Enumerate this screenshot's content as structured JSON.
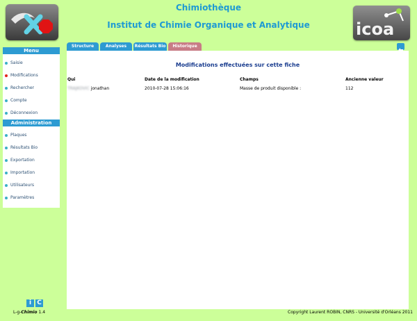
{
  "header": {
    "title": "Chimiothèque",
    "subtitle": "Institut de Chimie Organique et Analytique",
    "logo_right_text": "icoa"
  },
  "sidebar": {
    "menu_heading": "Menu",
    "menu_items": [
      {
        "label": "Saisie",
        "dot_color": "#3ab0c7"
      },
      {
        "label": "Modifications",
        "dot_color": "#e1261c"
      },
      {
        "label": "Rechercher",
        "dot_color": "#3ab0c7"
      },
      {
        "label": "Compte",
        "dot_color": "#3ab0c7"
      },
      {
        "label": "Déconnexion",
        "dot_color": "#3ab0c7"
      }
    ],
    "admin_heading": "Administration",
    "admin_items": [
      {
        "label": "Plaques",
        "dot_color": "#3ab0c7"
      },
      {
        "label": "Résultats Bio",
        "dot_color": "#3ab0c7"
      },
      {
        "label": "Exportation",
        "dot_color": "#3ab0c7"
      },
      {
        "label": "Importation",
        "dot_color": "#3ab0c7"
      },
      {
        "label": "Utilisateurs",
        "dot_color": "#3ab0c7"
      },
      {
        "label": "Paramètres",
        "dot_color": "#3ab0c7"
      }
    ]
  },
  "tabs": [
    {
      "label": "Structure",
      "color": "#2d9bd2"
    },
    {
      "label": "Analyses",
      "color": "#2d9bd2"
    },
    {
      "label": "Résultats Bio",
      "color": "#2d9bd2"
    },
    {
      "label": "Historique",
      "color": "#c87c86"
    }
  ],
  "main": {
    "title": "Modifications effectuées sur cette fiche",
    "columns": [
      "Qui",
      "Date de la modification",
      "Champs",
      "Ancienne valeur"
    ],
    "rows": [
      {
        "qui_name": "TRAJKOVIC",
        "qui_first": "jonathan",
        "date": "2010-07-28 15:06:16",
        "champs": "Masse de produit disponible :",
        "ancienne_valeur": "112"
      }
    ]
  },
  "footer": {
    "ic_letters": [
      "i",
      "C"
    ],
    "app_prefix": "L-g-",
    "app_name": "Chimio",
    "version": "1.4",
    "copyright": "Copyright Laurent ROBIN, CNRS - Université d'Orléans 2011"
  },
  "colors": {
    "background": "#ccff99",
    "accent": "#2d9bd2",
    "title": "#1e9ad3",
    "heading_blue": "#1a3d8f",
    "active_dot": "#e1261c"
  }
}
